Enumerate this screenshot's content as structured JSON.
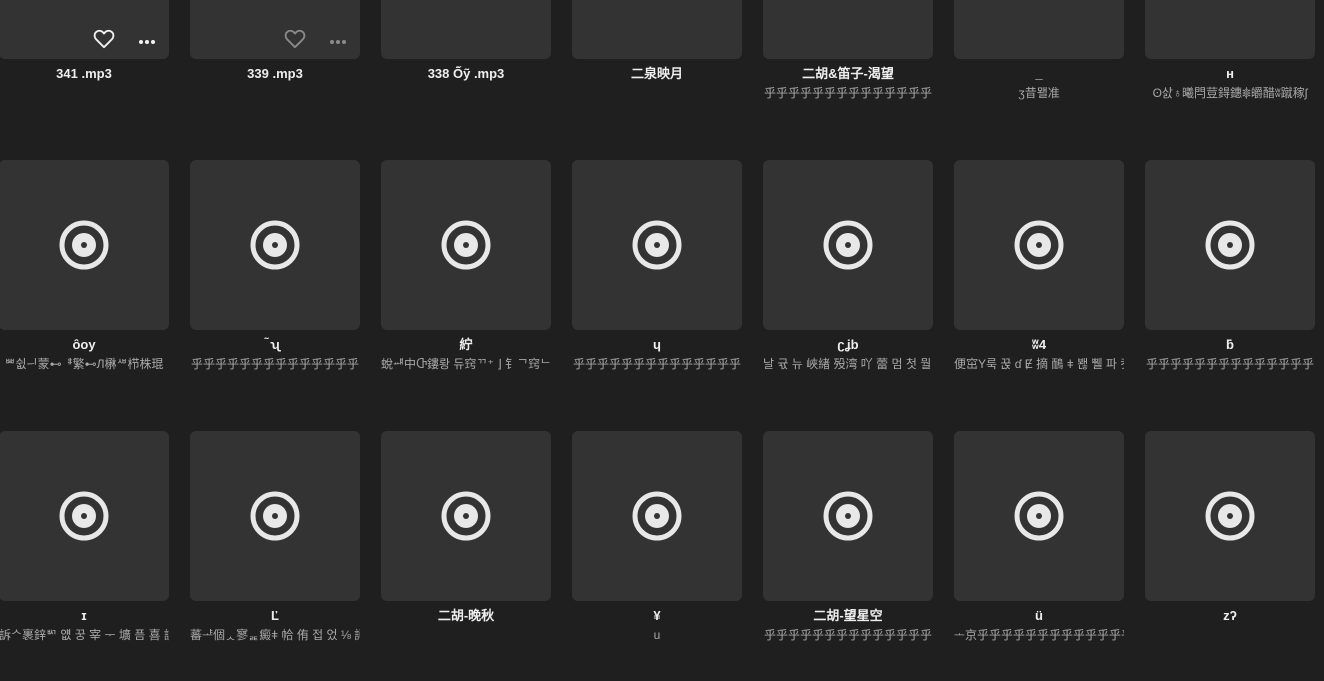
{
  "rows": [
    [
      {
        "title": "341 .mp3",
        "artist": "",
        "disc": false,
        "actions": "bright"
      },
      {
        "title": "339 .mp3",
        "artist": "",
        "disc": false,
        "actions": "dim"
      },
      {
        "title": "338 Ő̃ỹ .mp3",
        "artist": "",
        "disc": false,
        "actions": "none"
      },
      {
        "title": "二泉映月",
        "artist": "",
        "disc": false,
        "actions": "none"
      },
      {
        "title": "二胡&笛子-渴望",
        "artist": "乎乎乎乎乎乎乎乎乎乎乎乎乎乎",
        "disc": false,
        "actions": "none"
      },
      {
        "title": "_",
        "artist": "ʒ昔뫨准",
        "disc": false,
        "actions": "none"
      },
      {
        "title": "ʜ",
        "artist": "ʘ삸♁曦閂荳鍀鏸𖠀皭醋ʬ蹴稼ʃ",
        "disc": false,
        "actions": "none"
      }
    ],
    [
      {
        "title": "ôoy",
        "artist": "ᄤ쉾ᅴ蒙⊷ᆥ繁⊷Л楙ᄲ栉株琨",
        "disc": true,
        "actions": "none"
      },
      {
        "title": "̃ʯ",
        "artist": "乎乎乎乎乎乎乎乎乎乎乎乎乎乎",
        "disc": true,
        "actions": "none"
      },
      {
        "title": "紵",
        "artist": "蛻ᆅ中Ⴇ鏤뢍 듀窍ᄁ⁺ ⌋ 钅ᄀ窍ᄂ樱",
        "disc": true,
        "actions": "none"
      },
      {
        "title": "ɥ",
        "artist": "乎乎乎乎乎乎乎乎乎乎乎乎乎乎",
        "disc": true,
        "actions": "none"
      },
      {
        "title": "ʗʝb",
        "artist": "날 귟 뉴 峽緖 殁湾 吖 蕾 멈 첫 뭘 ᄆ",
        "disc": true,
        "actions": "none"
      },
      {
        "title": "ʬ4",
        "artist": "便窋Y룩 꾽 ɗ Ɇ 摘 鴯 ǂ 봲 쀌 파 캇",
        "disc": true,
        "actions": "none"
      },
      {
        "title": "ƃ",
        "artist": "乎乎乎乎乎乎乎乎乎乎乎乎乎乎",
        "disc": true,
        "actions": "none"
      }
    ],
    [
      {
        "title": "ɪ",
        "artist": "訴ᄉ裹鋅ᄢ 얪 꿍 宰 ᅮ 壙 픔 喜 謨 ᄿ",
        "disc": true,
        "actions": "none"
      },
      {
        "title": "Ľ",
        "artist": "蕃ᅸ個ᆺ寥ᆴ癜ǂ 帢 侑 접 었 ⅛ 訶 蕾ᆞ",
        "disc": true,
        "actions": "none"
      },
      {
        "title": "二胡-晚秋",
        "artist": "",
        "disc": true,
        "actions": "none"
      },
      {
        "title": "¥",
        "artist": "u",
        "disc": true,
        "actions": "none"
      },
      {
        "title": "二胡-望星空",
        "artist": "乎乎乎乎乎乎乎乎乎乎乎乎乎乎",
        "disc": true,
        "actions": "none"
      },
      {
        "title": "ü",
        "artist": "ᅩ京乎乎乎乎乎乎乎乎乎乎乎乎乎",
        "disc": true,
        "actions": "none"
      },
      {
        "title": "zʔ",
        "artist": "",
        "disc": true,
        "actions": "none"
      }
    ]
  ],
  "colors": {
    "background": "#1f1f1f",
    "cover": "#333333",
    "disc": "#e8e8e8",
    "title": "#eeeeee",
    "artist": "#a8a8a8"
  },
  "icons": {
    "cover_placeholder": "vinyl-disc-icon",
    "like": "heart-icon",
    "menu": "more-dots-icon"
  }
}
